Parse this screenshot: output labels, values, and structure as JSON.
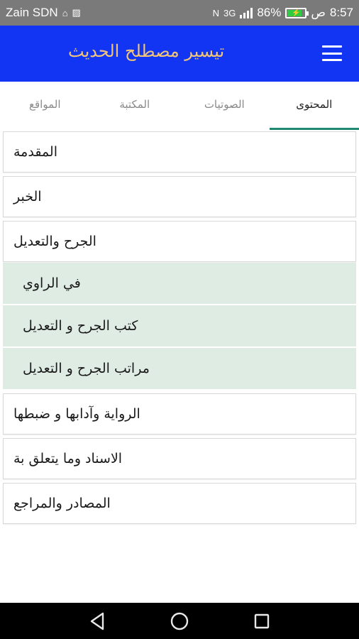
{
  "status_bar": {
    "carrier": "Zain SDN",
    "network": "3G",
    "battery_percent": "86%",
    "am_pm": "ص",
    "time": "8:57"
  },
  "app_bar": {
    "title": "تيسير مصطلح الحديث",
    "menu_icon": "hamburger-menu-icon",
    "background": "#1235f4",
    "title_color": "#f0c57a"
  },
  "tabs": [
    {
      "label": "المحتوى",
      "active": true
    },
    {
      "label": "الصوتيات",
      "active": false
    },
    {
      "label": "المكتبة",
      "active": false
    },
    {
      "label": "المواقع",
      "active": false
    }
  ],
  "list": {
    "items": [
      {
        "label": "المقدمة"
      },
      {
        "label": "الخبر"
      },
      {
        "label": "الجرح والتعديل"
      }
    ],
    "sub_items": [
      {
        "label": "في الراوي"
      },
      {
        "label": "كتب الجرح و التعديل"
      },
      {
        "label": "مراتب الجرح و التعديل"
      }
    ],
    "items_after": [
      {
        "label": "الرواية وآدابها و ضبطها"
      },
      {
        "label": "الاسناد وما يتعلق بة"
      },
      {
        "label": "المصادر والمراجع"
      }
    ]
  },
  "nav_bar": {
    "back_icon": "back-triangle-icon",
    "home_icon": "home-circle-icon",
    "recents_icon": "recents-square-icon"
  }
}
